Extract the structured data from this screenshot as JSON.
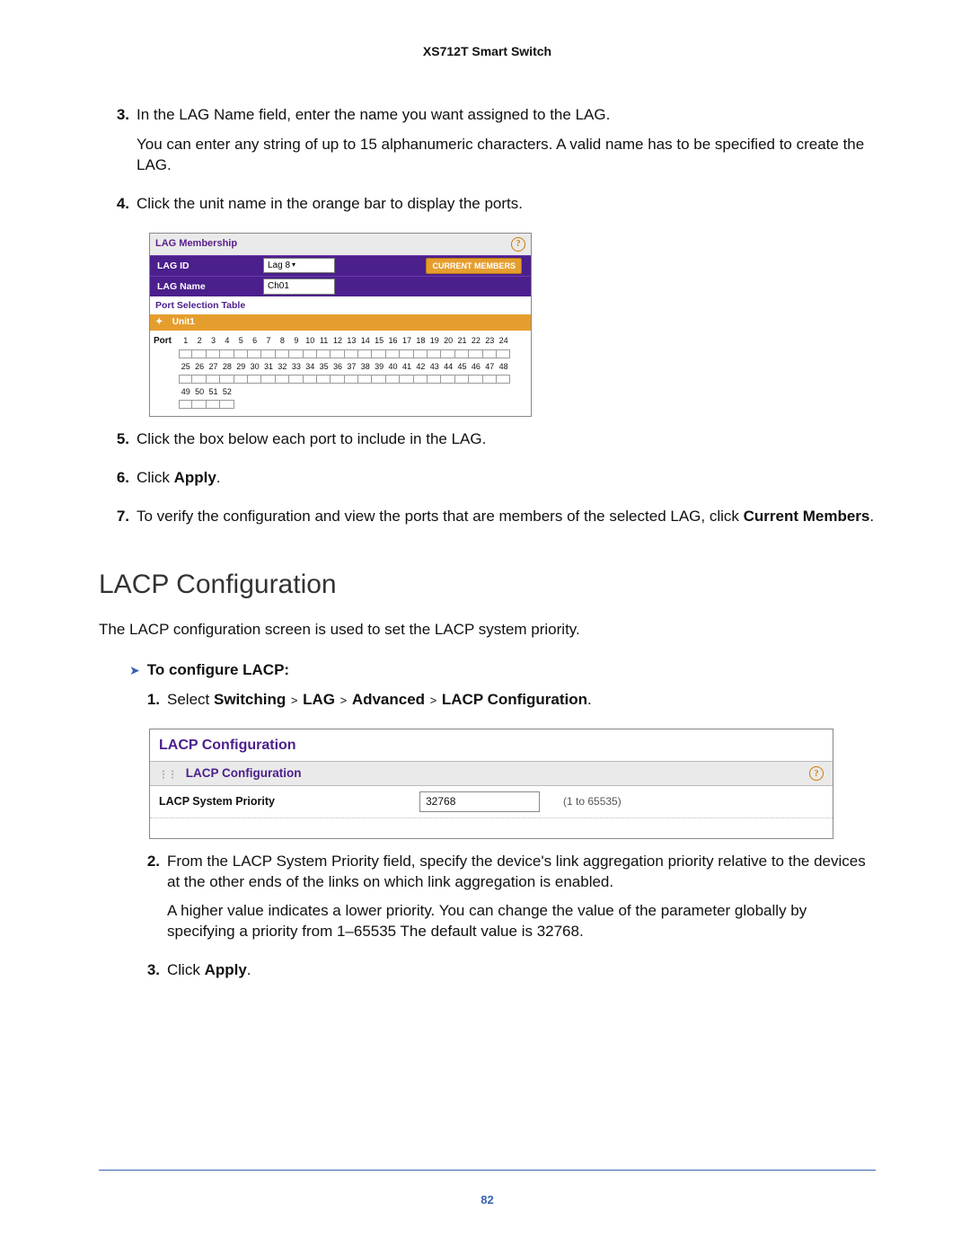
{
  "header_title": "XS712T Smart Switch",
  "page_number": "82",
  "steps_a": [
    {
      "num": "3.",
      "text": "In the LAG Name field, enter the name you want assigned to the LAG.",
      "extra": "You can enter any string of up to 15 alphanumeric characters. A valid name has to be specified to create the LAG."
    },
    {
      "num": "4.",
      "text": "Click the unit name in the orange bar to display the ports."
    }
  ],
  "steps_b": [
    {
      "num": "5.",
      "text": "Click the box below each port to include in the LAG."
    },
    {
      "num": "6.",
      "prefix": "Click ",
      "bold": "Apply",
      "suffix": "."
    },
    {
      "num": "7.",
      "prefix": "To verify the configuration and view the ports that are members of the selected LAG, click ",
      "bold": "Current Members",
      "suffix": "."
    }
  ],
  "section_title": "LACP Configuration",
  "section_intro": "The LACP configuration screen is used to set the LACP system priority.",
  "proc_heading": "To configure LACP:",
  "steps_c1": {
    "num": "1.",
    "prefix": "Select ",
    "path": [
      "Switching",
      "LAG",
      "Advanced",
      "LACP Configuration"
    ],
    "suffix": "."
  },
  "steps_c_rest": [
    {
      "num": "2.",
      "text": "From the LACP System Priority field, specify the device's link aggregation priority relative to the devices at the other ends of the links on which link aggregation is enabled.",
      "extra": "A higher value indicates a lower priority. You can change the value of the parameter globally by specifying a priority from 1–65535 The default value is 32768."
    },
    {
      "num": "3.",
      "prefix": "Click ",
      "bold": "Apply",
      "suffix": "."
    }
  ],
  "lag_panel": {
    "title": "LAG Membership",
    "lag_id_label": "LAG ID",
    "lag_id_value": "Lag 8",
    "lag_name_label": "LAG Name",
    "lag_name_value": "Ch01",
    "button": "CURRENT MEMBERS",
    "table_title": "Port Selection Table",
    "unit": "Unit1",
    "port_label": "Port",
    "row1": [
      "1",
      "2",
      "3",
      "4",
      "5",
      "6",
      "7",
      "8",
      "9",
      "10",
      "11",
      "12",
      "13",
      "14",
      "15",
      "16",
      "17",
      "18",
      "19",
      "20",
      "21",
      "22",
      "23",
      "24"
    ],
    "row2": [
      "25",
      "26",
      "27",
      "28",
      "29",
      "30",
      "31",
      "32",
      "33",
      "34",
      "35",
      "36",
      "37",
      "38",
      "39",
      "40",
      "41",
      "42",
      "43",
      "44",
      "45",
      "46",
      "47",
      "48"
    ],
    "row3": [
      "49",
      "50",
      "51",
      "52"
    ]
  },
  "lacp_panel": {
    "big_title": "LACP Configuration",
    "sub_title": "LACP Configuration",
    "field_label": "LACP System Priority",
    "field_value": "32768",
    "field_hint": "(1 to 65535)"
  }
}
